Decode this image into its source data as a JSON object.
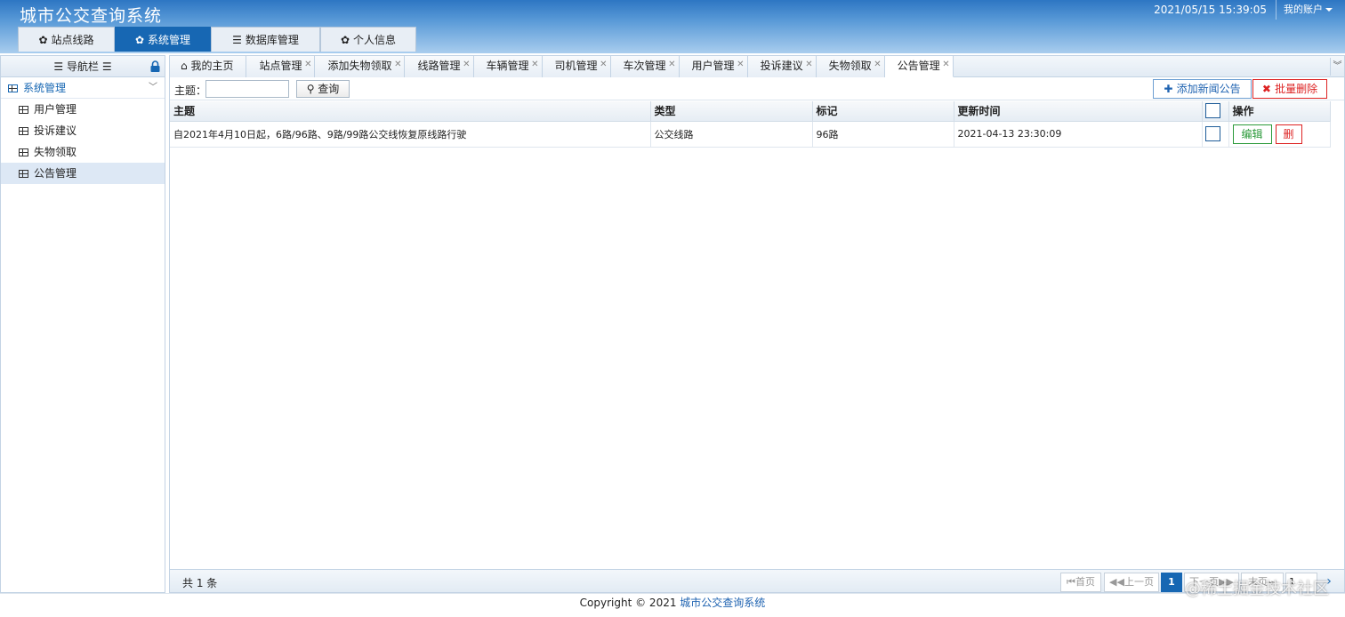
{
  "header": {
    "title": "城市公交查询系统",
    "datetime": "2021/05/15 15:39:05",
    "account_label": "我的账户"
  },
  "main_tabs": [
    {
      "label": "站点线路",
      "active": false
    },
    {
      "label": "系统管理",
      "active": true
    },
    {
      "label": "数据库管理",
      "active": false
    },
    {
      "label": "个人信息",
      "active": false
    }
  ],
  "sidebar": {
    "title": "导航栏",
    "group": "系统管理",
    "items": [
      {
        "label": "用户管理",
        "active": false
      },
      {
        "label": "投诉建议",
        "active": false
      },
      {
        "label": "失物领取",
        "active": false
      },
      {
        "label": "公告管理",
        "active": true
      }
    ]
  },
  "content_tabs": [
    {
      "label": "我的主页",
      "closable": false,
      "active": false
    },
    {
      "label": "站点管理",
      "closable": true,
      "active": false
    },
    {
      "label": "添加失物领取",
      "closable": true,
      "active": false
    },
    {
      "label": "线路管理",
      "closable": true,
      "active": false
    },
    {
      "label": "车辆管理",
      "closable": true,
      "active": false
    },
    {
      "label": "司机管理",
      "closable": true,
      "active": false
    },
    {
      "label": "车次管理",
      "closable": true,
      "active": false
    },
    {
      "label": "用户管理",
      "closable": true,
      "active": false
    },
    {
      "label": "投诉建议",
      "closable": true,
      "active": false
    },
    {
      "label": "失物领取",
      "closable": true,
      "active": false
    },
    {
      "label": "公告管理",
      "closable": true,
      "active": true
    }
  ],
  "toolbar": {
    "search_label": "主题：",
    "search_value": "",
    "query_label": "查询",
    "add_label": "添加新闻公告",
    "batch_delete_label": "批量删除"
  },
  "table": {
    "columns": [
      "主题",
      "类型",
      "标记",
      "更新时间",
      "",
      "操作"
    ],
    "rows": [
      {
        "subject": "自2021年4月10日起，6路/96路、9路/99路公交线恢复原线路行驶",
        "type": "公交线路",
        "tag": "96路",
        "updated": "2021-04-13 23:30:09",
        "edit_label": "编辑",
        "delete_label": "删"
      }
    ]
  },
  "pager": {
    "total": "共 1 条",
    "first": "首页",
    "prev": "上一页",
    "current": "1",
    "next": "下一页",
    "last": "末页",
    "page_input": "1"
  },
  "footer": {
    "copyright": "Copyright © 2021 ",
    "link": "城市公交查询系统"
  },
  "watermark": "@稀土掘金技术社区",
  "colors": {
    "accent": "#1767b3",
    "danger": "#dd2222",
    "success": "#2b9a3a"
  }
}
